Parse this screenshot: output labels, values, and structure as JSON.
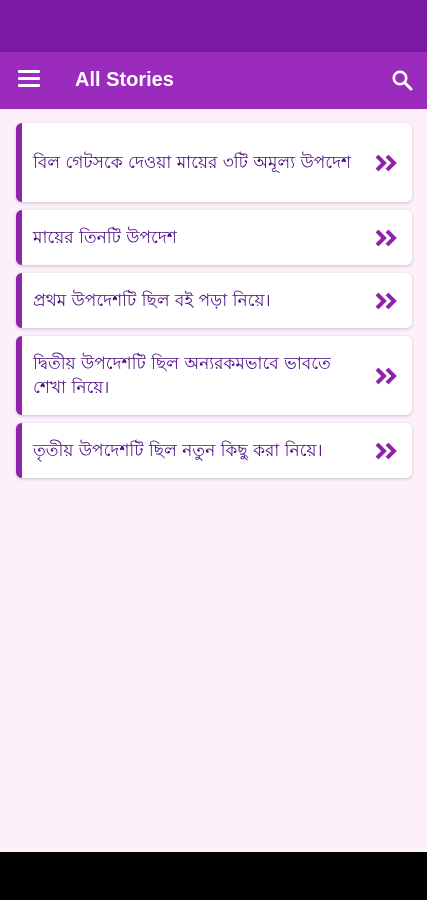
{
  "header": {
    "title": "All Stories",
    "menu_icon": "hamburger-menu-icon",
    "search_icon": "search-icon"
  },
  "colors": {
    "status_bar": "#7a1aa4",
    "app_bar": "#9a2bbd",
    "accent": "#8e24aa",
    "card_text": "#4a0a82",
    "background": "#fcf0fa"
  },
  "stories": [
    {
      "title": "বিল গেটসকে দেওয়া মায়ের ৩টি অমূল্য উপদেশ"
    },
    {
      "title": "মায়ের তিনটি উপদেশ"
    },
    {
      "title": "প্রথম উপদেশটি ছিল বই পড়া নিয়ে।"
    },
    {
      "title": "দ্বিতীয় উপদেশটি ছিল অন্যরকমভাবে ভাবতে শেখা নিয়ে।"
    },
    {
      "title": "তৃতীয় উপদেশটি ছিল নতুন কিছু করা নিয়ে।"
    }
  ]
}
